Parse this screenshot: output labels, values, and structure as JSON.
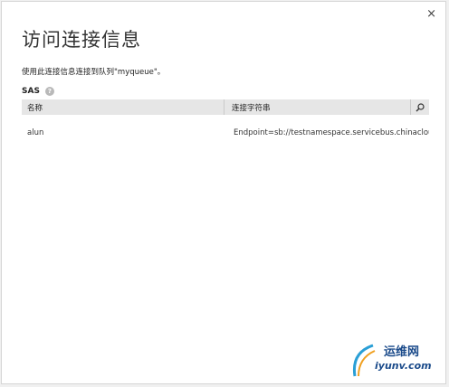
{
  "dialog": {
    "title": "访问连接信息",
    "description": "使用此连接信息连接到队列\"myqueue\"。",
    "close_label": "×"
  },
  "section": {
    "label": "SAS",
    "help_icon": "question-icon"
  },
  "table": {
    "columns": [
      "名称",
      "连接字符串"
    ],
    "search_icon": "search-icon",
    "rows": [
      {
        "name": "alun",
        "connection": "Endpoint=sb://testnamespace.servicebus.chinacloudapi.cn/;"
      }
    ]
  },
  "watermark": {
    "text_cn": "运维网",
    "text_en": "iyunv.com"
  },
  "colors": {
    "header_bg": "#e6e6e6",
    "accent": "#1a4a8a"
  }
}
